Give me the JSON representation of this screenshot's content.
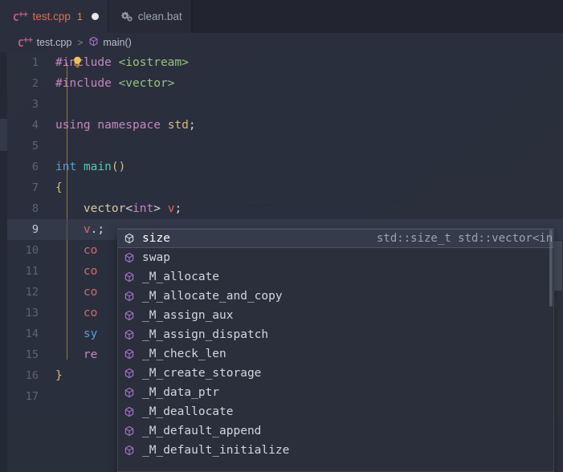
{
  "window": {
    "theme_bg": "#2b2f3d",
    "accent": "#e06c55"
  },
  "tabs": [
    {
      "name": "test.cpp",
      "icon": "cpp-icon",
      "badge": "1",
      "dirty": true,
      "active": true
    },
    {
      "name": "clean.bat",
      "icon": "gears-icon",
      "badge": "",
      "dirty": false,
      "active": false
    }
  ],
  "breadcrumb": {
    "file": "test.cpp",
    "separator": ">",
    "symbol": "main()"
  },
  "editor": {
    "lines": [
      {
        "num": "1",
        "text": "#include <iostream>"
      },
      {
        "num": "2",
        "text": "#include <vector>"
      },
      {
        "num": "3",
        "text": ""
      },
      {
        "num": "4",
        "text": "using namespace std;"
      },
      {
        "num": "5",
        "text": ""
      },
      {
        "num": "6",
        "text": "int main()"
      },
      {
        "num": "7",
        "text": "{"
      },
      {
        "num": "8",
        "text": "    vector<int> v;"
      },
      {
        "num": "9",
        "text": "    v.;"
      },
      {
        "num": "10",
        "text": "    co"
      },
      {
        "num": "11",
        "text": "    co"
      },
      {
        "num": "12",
        "text": "    co"
      },
      {
        "num": "13",
        "text": "    co"
      },
      {
        "num": "14",
        "text": "    sy"
      },
      {
        "num": "15",
        "text": "    re"
      },
      {
        "num": "16",
        "text": "}"
      },
      {
        "num": "17",
        "text": ""
      }
    ],
    "active_line": "9",
    "lightbulb": "lightbulb-icon"
  },
  "suggestions": {
    "selected_index": 0,
    "items": [
      {
        "label": "size",
        "detail": "std::size_t std::vector<int>::size(…",
        "icon": "method-cube-icon"
      },
      {
        "label": "swap",
        "detail": "",
        "icon": "method-cube-icon"
      },
      {
        "label": "_M_allocate",
        "detail": "",
        "icon": "method-cube-icon"
      },
      {
        "label": "_M_allocate_and_copy",
        "detail": "",
        "icon": "method-cube-icon"
      },
      {
        "label": "_M_assign_aux",
        "detail": "",
        "icon": "method-cube-icon"
      },
      {
        "label": "_M_assign_dispatch",
        "detail": "",
        "icon": "method-cube-icon"
      },
      {
        "label": "_M_check_len",
        "detail": "",
        "icon": "method-cube-icon"
      },
      {
        "label": "_M_create_storage",
        "detail": "",
        "icon": "method-cube-icon"
      },
      {
        "label": "_M_data_ptr",
        "detail": "",
        "icon": "method-cube-icon"
      },
      {
        "label": "_M_deallocate",
        "detail": "",
        "icon": "method-cube-icon"
      },
      {
        "label": "_M_default_append",
        "detail": "",
        "icon": "method-cube-icon"
      },
      {
        "label": "_M_default_initialize",
        "detail": "",
        "icon": "method-cube-icon"
      }
    ]
  }
}
